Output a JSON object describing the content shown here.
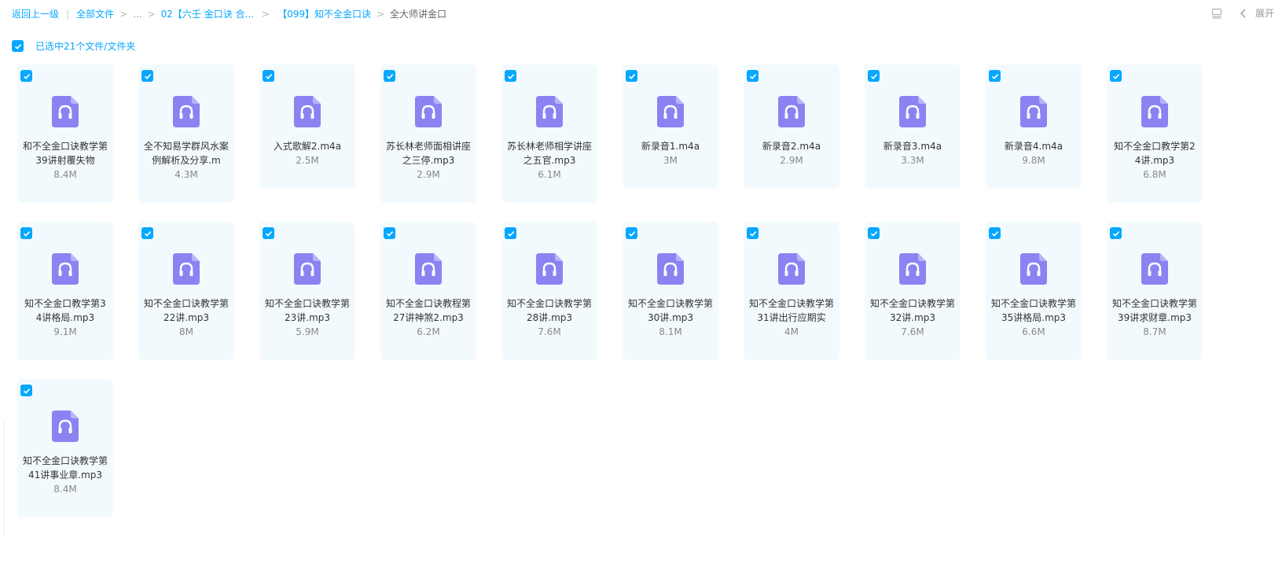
{
  "breadcrumb": {
    "back_label": "返回上一级",
    "all_files_label": "全部文件",
    "ellipsis_label": "...",
    "folder1_label": "02【六壬 金口诀 合...",
    "folder2_label": "【099】知不全金口诀",
    "current_label": "全大师讲金口"
  },
  "toolbar": {
    "expand_label": "展开",
    "list_view_icon": "list-view-icon",
    "collapse_icon": "chevron-left-icon"
  },
  "selection": {
    "text": "已选中21个文件/文件夹",
    "checked": true
  },
  "colors": {
    "accent": "#06a7ff",
    "card_bg": "#f3fafe",
    "audio_icon": "#8b83f2"
  },
  "files": [
    {
      "name": "和不全金口诀教学第39讲射覆失物",
      "size": "8.4M",
      "icon": "audio-file-icon"
    },
    {
      "name": "全不知易学群风水案例解析及分享.m",
      "size": "4.3M",
      "icon": "audio-file-icon"
    },
    {
      "name": "入式歌解2.m4a",
      "size": "2.5M",
      "icon": "audio-file-icon"
    },
    {
      "name": "苏长林老师面相讲座之三停.mp3",
      "size": "2.9M",
      "icon": "audio-file-icon"
    },
    {
      "name": "苏长林老师相学讲座之五官.mp3",
      "size": "6.1M",
      "icon": "audio-file-icon"
    },
    {
      "name": "新录音1.m4a",
      "size": "3M",
      "icon": "audio-file-icon"
    },
    {
      "name": "新录音2.m4a",
      "size": "2.9M",
      "icon": "audio-file-icon"
    },
    {
      "name": "新录音3.m4a",
      "size": "3.3M",
      "icon": "audio-file-icon"
    },
    {
      "name": "新录音4.m4a",
      "size": "9.8M",
      "icon": "audio-file-icon"
    },
    {
      "name": "知不全金口教学第24讲.mp3",
      "size": "6.8M",
      "icon": "audio-file-icon"
    },
    {
      "name": "知不全金口教学第34讲格局.mp3",
      "size": "9.1M",
      "icon": "audio-file-icon"
    },
    {
      "name": "知不全金口诀教学第22讲.mp3",
      "size": "8M",
      "icon": "audio-file-icon"
    },
    {
      "name": "知不全金口诀教学第23讲.mp3",
      "size": "5.9M",
      "icon": "audio-file-icon"
    },
    {
      "name": "知不全金口诀教程第27讲神煞2.mp3",
      "size": "6.2M",
      "icon": "audio-file-icon"
    },
    {
      "name": "知不全金口诀教学第28讲.mp3",
      "size": "7.6M",
      "icon": "audio-file-icon"
    },
    {
      "name": "知不全金口诀教学第30讲.mp3",
      "size": "8.1M",
      "icon": "audio-file-icon"
    },
    {
      "name": "知不全金口诀教学第31讲出行应期实",
      "size": "4M",
      "icon": "audio-file-icon"
    },
    {
      "name": "知不全金口诀教学第32讲.mp3",
      "size": "7.6M",
      "icon": "audio-file-icon"
    },
    {
      "name": "知不全金口诀教学第35讲格局.mp3",
      "size": "6.6M",
      "icon": "audio-file-icon"
    },
    {
      "name": "知不全金口诀教学第39讲求财章.mp3",
      "size": "8.7M",
      "icon": "audio-file-icon"
    },
    {
      "name": "知不全金口诀教学第41讲事业章.mp3",
      "size": "8.4M",
      "icon": "audio-file-icon"
    }
  ]
}
